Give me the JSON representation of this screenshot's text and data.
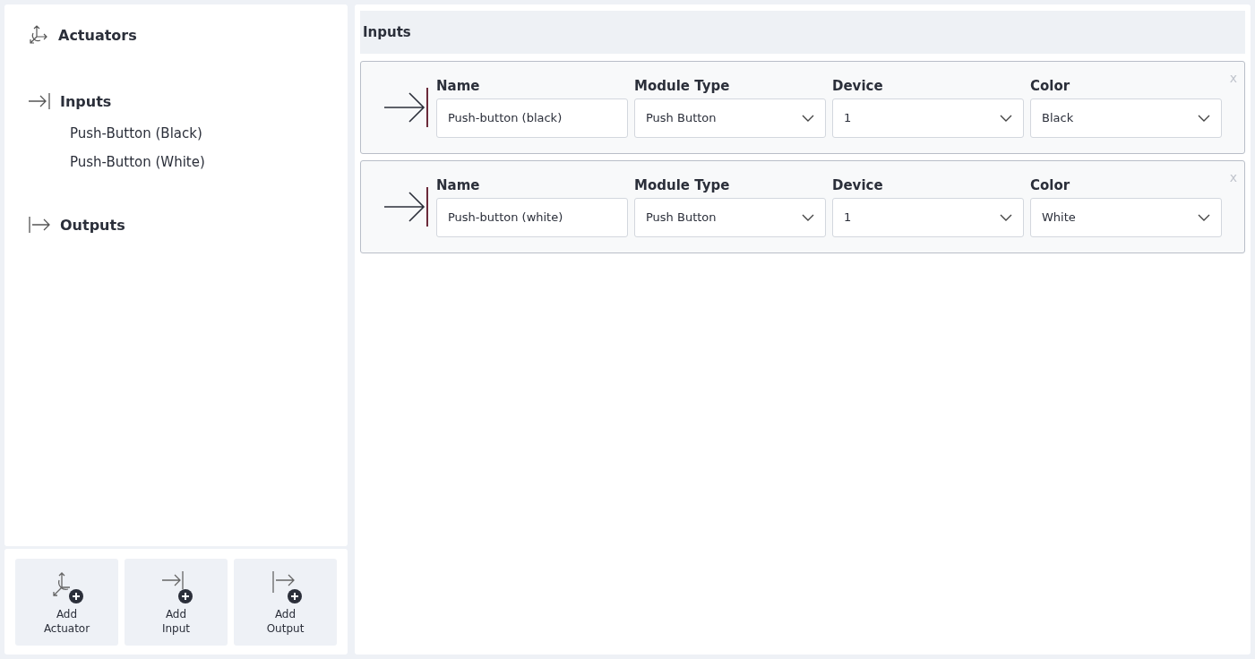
{
  "sidebar": {
    "sections": [
      {
        "kind": "actuator",
        "label": "Actuators"
      },
      {
        "kind": "input",
        "label": "Inputs",
        "children": [
          {
            "label": "Push-Button (Black)"
          },
          {
            "label": "Push-Button (White)"
          }
        ]
      },
      {
        "kind": "output",
        "label": "Outputs"
      }
    ],
    "actions": [
      {
        "kind": "actuator",
        "label": "Add Actuator"
      },
      {
        "kind": "input",
        "label": "Add Input"
      },
      {
        "kind": "output",
        "label": "Add Output"
      }
    ]
  },
  "main": {
    "title": "Inputs",
    "cards": [
      {
        "kind": "input",
        "close": "x",
        "fields": [
          {
            "kind": "text",
            "label": "Name",
            "value": "Push-button (black)"
          },
          {
            "kind": "select",
            "label": "Module Type",
            "value": "Push Button"
          },
          {
            "kind": "select",
            "label": "Device",
            "value": "1"
          },
          {
            "kind": "select",
            "label": "Color",
            "value": "Black"
          }
        ]
      },
      {
        "kind": "input",
        "close": "x",
        "fields": [
          {
            "kind": "text",
            "label": "Name",
            "value": "Push-button (white)"
          },
          {
            "kind": "select",
            "label": "Module Type",
            "value": "Push Button"
          },
          {
            "kind": "select",
            "label": "Device",
            "value": "1"
          },
          {
            "kind": "select",
            "label": "Color",
            "value": "White"
          }
        ]
      }
    ]
  }
}
